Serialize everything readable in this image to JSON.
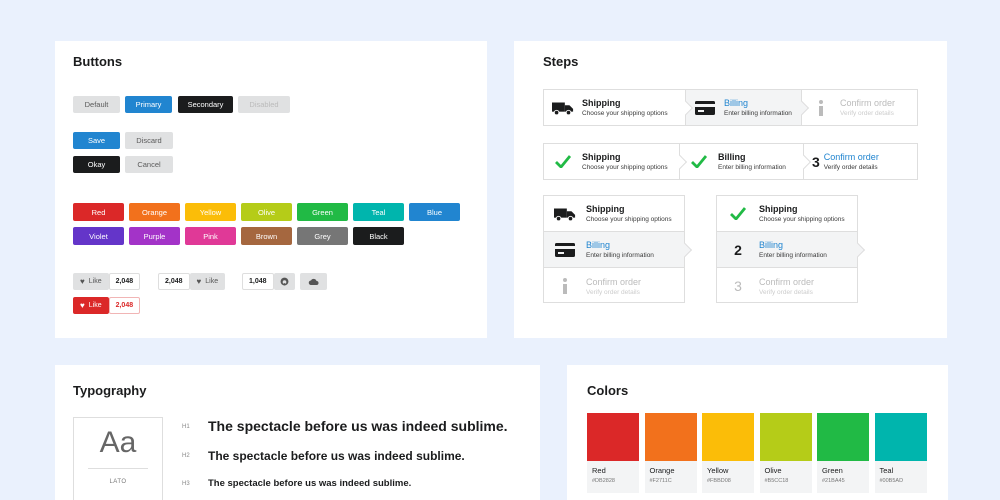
{
  "buttons_card": {
    "title": "Buttons",
    "basic": [
      "Default",
      "Primary",
      "Secondary",
      "Disabled"
    ],
    "save": "Save",
    "discard": "Discard",
    "okay": "Okay",
    "cancel": "Cancel",
    "colors_row1": [
      {
        "label": "Red",
        "color": "#DB2828"
      },
      {
        "label": "Orange",
        "color": "#F2711C"
      },
      {
        "label": "Yellow",
        "color": "#FBBD08"
      },
      {
        "label": "Olive",
        "color": "#B5CC18"
      },
      {
        "label": "Green",
        "color": "#21BA45"
      },
      {
        "label": "Teal",
        "color": "#00B5AD"
      },
      {
        "label": "Blue",
        "color": "#2185D0"
      }
    ],
    "colors_row2": [
      {
        "label": "Violet",
        "color": "#6435C9"
      },
      {
        "label": "Purple",
        "color": "#A333C8"
      },
      {
        "label": "Pink",
        "color": "#E03997"
      },
      {
        "label": "Brown",
        "color": "#A5673F"
      },
      {
        "label": "Grey",
        "color": "#767676"
      },
      {
        "label": "Black",
        "color": "#1B1C1D"
      }
    ],
    "like_label": "Like",
    "like_count_1": "2,048",
    "like_count_2": "2,048",
    "like_count_3": "1,048",
    "like_count_red": "2,048"
  },
  "steps_card": {
    "title": "Steps",
    "shipping": "Shipping",
    "shipping_desc": "Choose your shipping options",
    "billing": "Billing",
    "billing_desc": "Enter billing information",
    "confirm": "Confirm order",
    "confirm_desc": "Verify order details",
    "num_2": "2",
    "num_3": "3"
  },
  "typography_card": {
    "title": "Typography",
    "font_sample": "Aa",
    "font_name": "LATO",
    "h1_label": "H1",
    "h2_label": "H2",
    "h3_label": "H3",
    "sample_text": "The spectacle before us was indeed sublime."
  },
  "colors_card": {
    "title": "Colors",
    "swatches": [
      {
        "name": "Red",
        "hex": "#DB2828"
      },
      {
        "name": "Orange",
        "hex": "#F2711C"
      },
      {
        "name": "Yellow",
        "hex": "#FBBD08"
      },
      {
        "name": "Olive",
        "hex": "#B5CC18"
      },
      {
        "name": "Green",
        "hex": "#21BA45"
      },
      {
        "name": "Teal",
        "hex": "#00B5AD"
      }
    ]
  }
}
